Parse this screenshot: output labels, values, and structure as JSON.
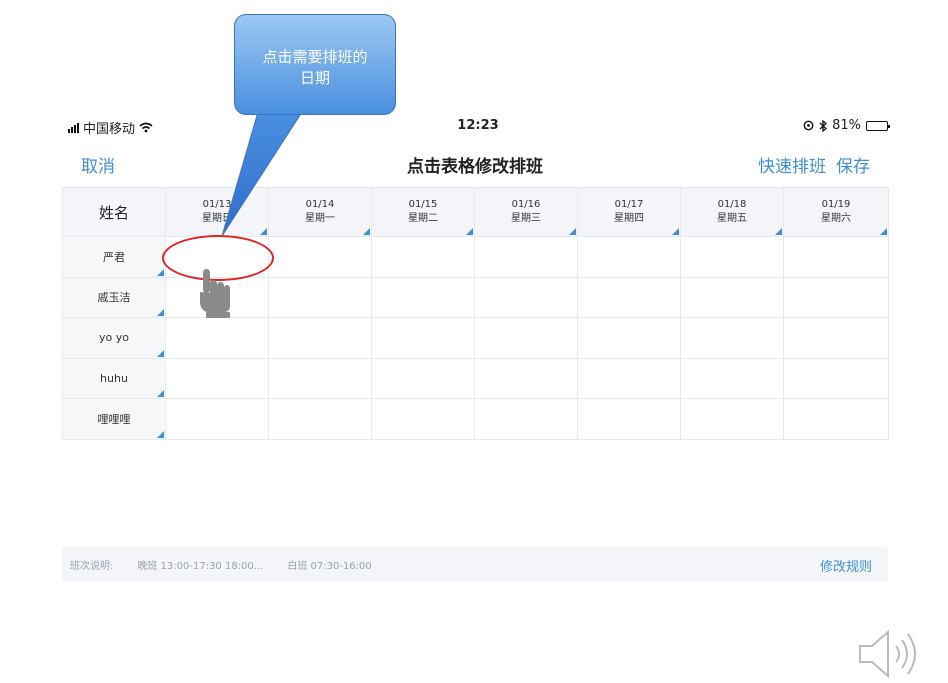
{
  "callout": {
    "line1": "点击需要排班的",
    "line2": "日期"
  },
  "status_bar": {
    "carrier": "中国移动",
    "time": "12:23",
    "battery": "81%",
    "battery_level": 0.81
  },
  "nav": {
    "cancel": "取消",
    "title": "点击表格修改排班",
    "quick_schedule": "快速排班",
    "save": "保存"
  },
  "table": {
    "name_header": "姓名",
    "dates": [
      {
        "date": "01/13",
        "weekday": "星期日"
      },
      {
        "date": "01/14",
        "weekday": "星期一"
      },
      {
        "date": "01/15",
        "weekday": "星期二"
      },
      {
        "date": "01/16",
        "weekday": "星期三"
      },
      {
        "date": "01/17",
        "weekday": "星期四"
      },
      {
        "date": "01/18",
        "weekday": "星期五"
      },
      {
        "date": "01/19",
        "weekday": "星期六"
      }
    ],
    "rows": [
      {
        "name": "严君"
      },
      {
        "name": "戚玉洁"
      },
      {
        "name": "yo yo"
      },
      {
        "name": "huhu"
      },
      {
        "name": "哩哩哩"
      }
    ]
  },
  "footer": {
    "label": "班次说明:",
    "shift1": "晚班 13:00-17:30  18:00...",
    "shift2": "白班 07:30-16:00",
    "modify_rules": "修改规则"
  },
  "colors": {
    "accent": "#3d8fd6",
    "header_bg": "#f3f5f8",
    "highlight": "#e02424"
  },
  "icons": [
    "signal-icon",
    "wifi-icon",
    "alarm-icon",
    "bluetooth-icon",
    "battery-icon",
    "hand-pointer-icon",
    "speaker-icon"
  ]
}
